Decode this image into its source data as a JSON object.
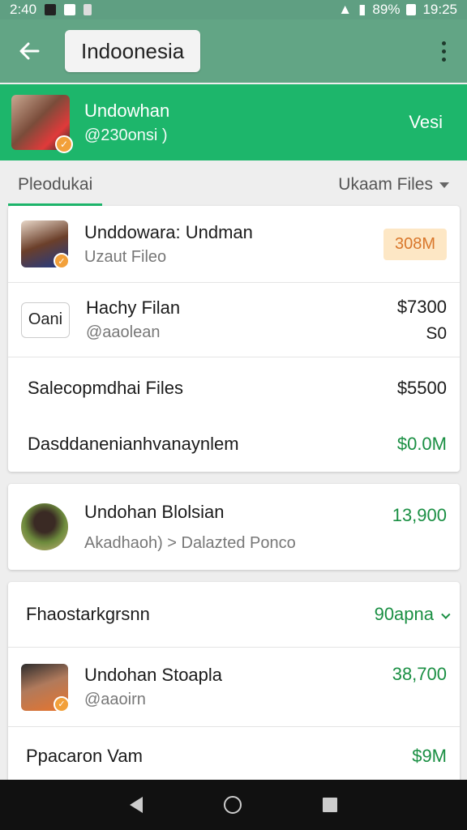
{
  "status_bar": {
    "time_left": "2:40",
    "battery": "89%",
    "clock": "19:25"
  },
  "app_bar": {
    "title": "Indoonesia"
  },
  "profile": {
    "name": "Undowhan",
    "subtitle": "@230onsi )",
    "action": "Vesi"
  },
  "tabs": {
    "active": "Pleodukai",
    "dropdown": "Ukaam Files"
  },
  "cards": [
    {
      "rows": [
        {
          "title": "Unddowara: Undman",
          "subtitle": "Uzaut Fileo",
          "pill": "308M"
        },
        {
          "logo_text": "Oani",
          "title": "Hachy Filan",
          "subtitle": "@aaolean",
          "value": "$7300",
          "value_sub": "S0"
        },
        {
          "title": "Salecopmdhai Files",
          "value": "$5500"
        },
        {
          "title": "Dasddanenianhvanaynlem",
          "value": "$0.0M"
        }
      ]
    },
    {
      "rows": [
        {
          "title": "Undohan Blolsian",
          "subtitle": "Akadhaoh) > Dalazted Ponco",
          "value": "13,900"
        }
      ]
    },
    {
      "rows": [
        {
          "title": "Fhaostarkgrsnn",
          "value": "90apna"
        },
        {
          "title": "Undohan Stoapla",
          "subtitle": "@aaoirn",
          "value": "38,700"
        },
        {
          "title": "Ppacaron Vam",
          "value": "$9M"
        }
      ]
    }
  ],
  "colors": {
    "accent": "#1db66b",
    "toolbar": "#62a585",
    "positive": "#1a8f43",
    "pill_bg": "#fde7c5",
    "pill_text": "#d9772b"
  }
}
